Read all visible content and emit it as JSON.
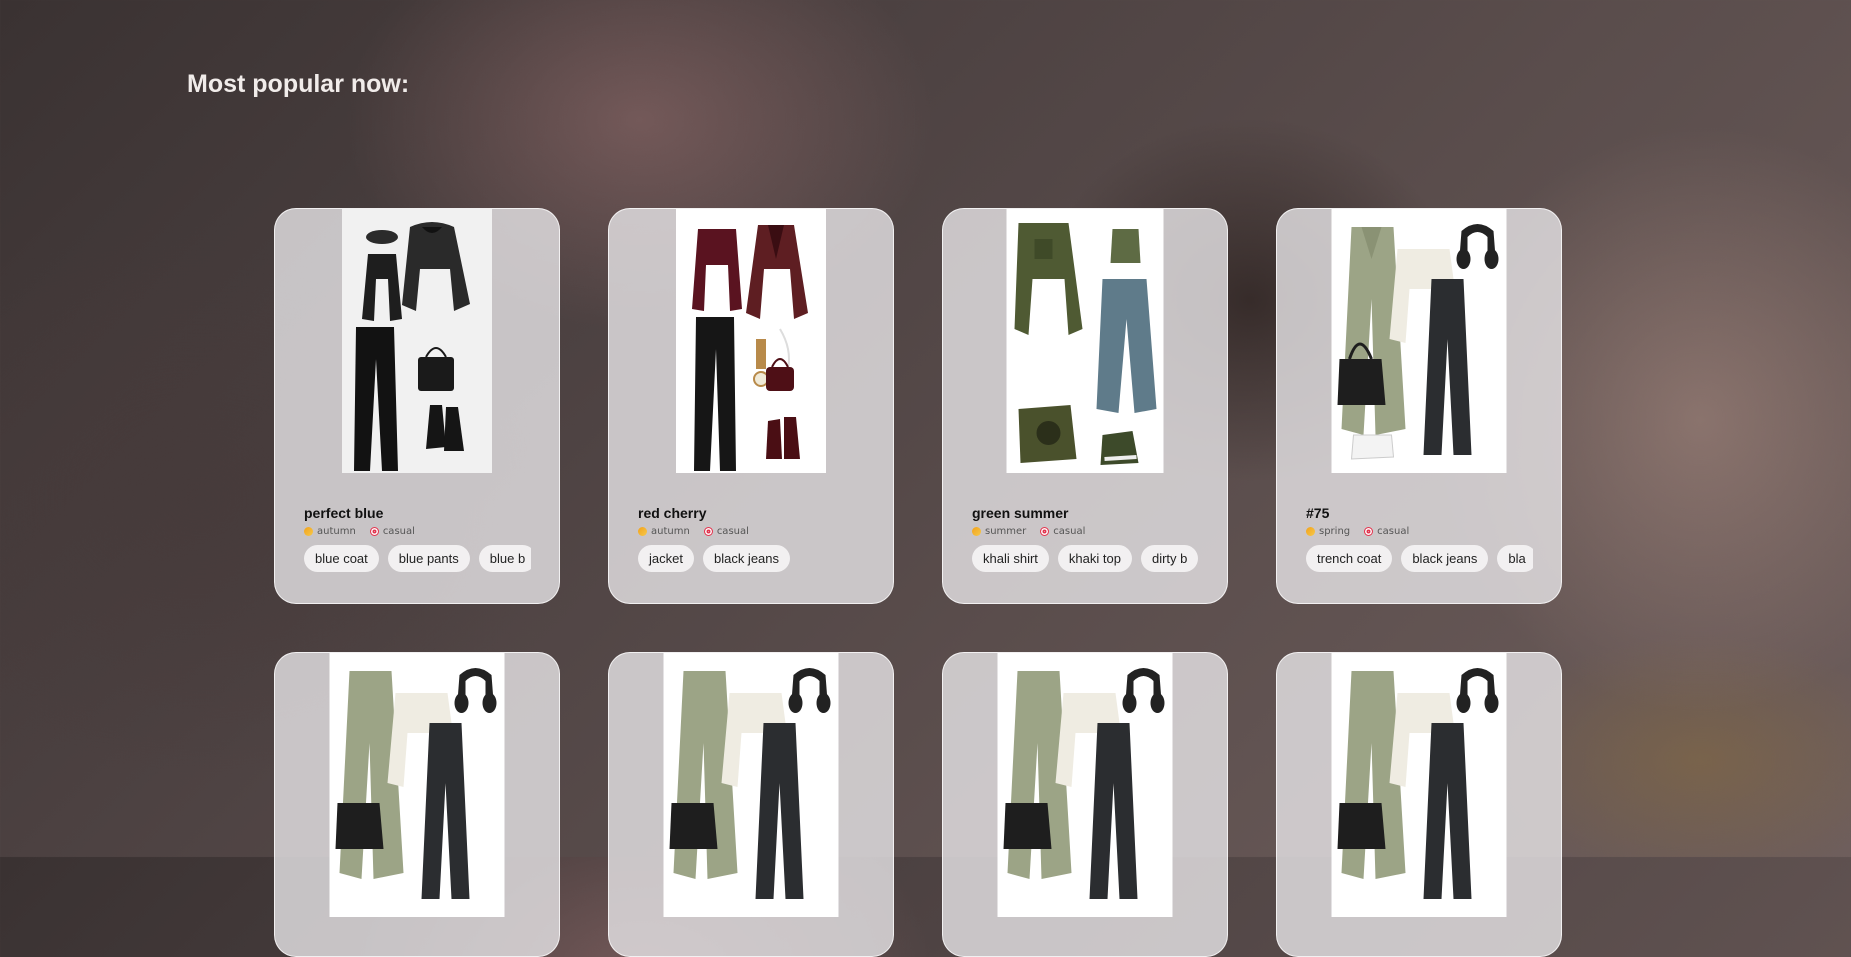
{
  "page": {
    "heading": "Most popular now:"
  },
  "outfits": [
    {
      "name": "perfect blue",
      "season": "autumn",
      "style": "casual",
      "tags": [
        "blue coat",
        "blue pants",
        "blue b"
      ]
    },
    {
      "name": "red cherry",
      "season": "autumn",
      "style": "casual",
      "tags": [
        "jacket",
        "black jeans"
      ]
    },
    {
      "name": "green summer",
      "season": "summer",
      "style": "casual",
      "tags": [
        "khali shirt",
        "khaki top",
        "dirty b"
      ]
    },
    {
      "name": "#75",
      "season": "spring",
      "style": "casual",
      "tags": [
        "trench coat",
        "black jeans",
        "bla"
      ]
    }
  ],
  "icons": {
    "season": "sun-icon",
    "style": "target-icon"
  }
}
